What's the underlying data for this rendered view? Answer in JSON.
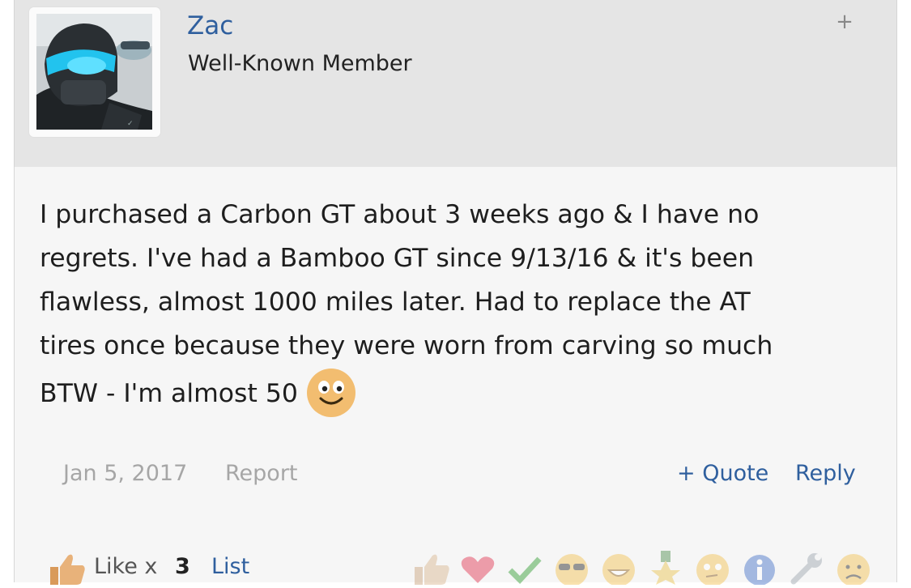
{
  "author": {
    "username": "Zac",
    "title": "Well-Known Member",
    "expand_symbol": "+"
  },
  "post": {
    "lines": [
      "I purchased a Carbon GT about 3 weeks ago & I have no",
      "regrets. I've had a Bamboo GT since 9/13/16 & it's been",
      "flawless, almost 1000 miles later. Had to replace the AT",
      "tires once because they were worn from carving so much",
      "BTW - I'm almost 50"
    ],
    "emoji": "smiley-icon",
    "date": "Jan 5, 2017",
    "report_label": "Report",
    "quote_label": "+ Quote",
    "reply_label": "Reply"
  },
  "likes": {
    "label": "Like x",
    "count": "3",
    "list_label": "List"
  },
  "reactions": [
    "like-icon",
    "heart-icon",
    "check-icon",
    "cool-icon",
    "laugh-icon",
    "medal-icon",
    "thinking-icon",
    "info-icon",
    "wrench-icon",
    "sad-icon"
  ],
  "colors": {
    "link": "#2f5f9e",
    "muted": "#a6a6a6",
    "header_bg": "#e5e5e5",
    "body_bg": "#f6f6f6"
  }
}
